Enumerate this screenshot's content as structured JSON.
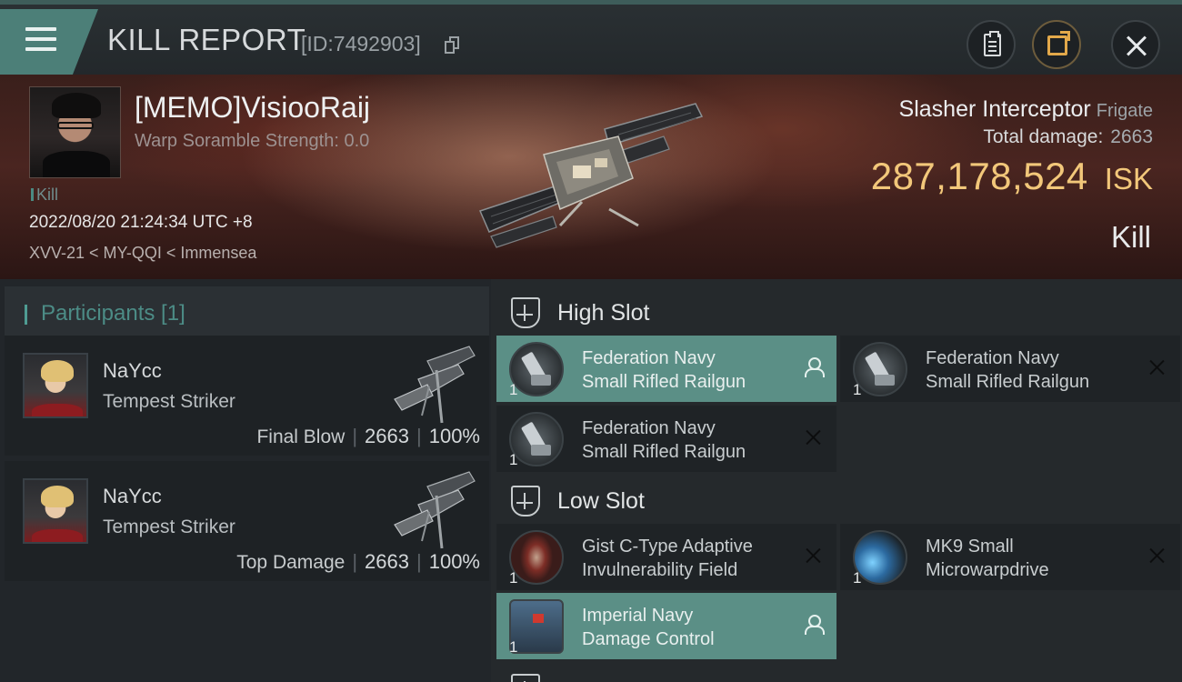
{
  "header": {
    "title": "KILL REPORT",
    "kill_id": "[ID:7492903]"
  },
  "victim": {
    "name": "[MEMO]VisiooRaij",
    "warp_scramble": "Warp Soramble Strength: 0.0",
    "kill_tag": "Kill",
    "datetime": "2022/08/20 21:24:34 UTC +8",
    "location": "XVV-21 < MY-QQI < Immensea",
    "ship_name": "Slasher Interceptor",
    "ship_class": "Frigate",
    "total_damage_label": "Total damage:",
    "total_damage": "2663",
    "isk_value": "287,178,524",
    "isk_unit": "ISK",
    "result": "Kill"
  },
  "participants": {
    "title": "Participants [1]",
    "items": [
      {
        "name": "NaYcc",
        "ship": "Tempest Striker",
        "label": "Final Blow",
        "damage": "2663",
        "percent": "100%"
      },
      {
        "name": "NaYcc",
        "ship": "Tempest Striker",
        "label": "Top Damage",
        "damage": "2663",
        "percent": "100%"
      }
    ]
  },
  "fitting": {
    "high_slot_title": "High Slot",
    "low_slot_title": "Low Slot",
    "high_slot": [
      {
        "name_line1": "Federation Navy",
        "name_line2": "Small Rifled Railgun",
        "qty": "1",
        "status": "dropped",
        "icon": "railgun-icon"
      },
      {
        "name_line1": "Federation Navy",
        "name_line2": "Small Rifled Railgun",
        "qty": "1",
        "status": "destroyed",
        "icon": "railgun-icon"
      },
      {
        "name_line1": "Federation Navy",
        "name_line2": "Small Rifled Railgun",
        "qty": "1",
        "status": "destroyed",
        "icon": "railgun-icon"
      }
    ],
    "low_slot": [
      {
        "name_line1": "Gist C-Type Adaptive",
        "name_line2": "Invulnerability Field",
        "qty": "1",
        "status": "destroyed",
        "icon": "invulnerability-field-icon"
      },
      {
        "name_line1": "MK9 Small",
        "name_line2": "Microwarpdrive",
        "qty": "1",
        "status": "destroyed",
        "icon": "microwarpdrive-icon"
      },
      {
        "name_line1": "Imperial Navy",
        "name_line2": "Damage Control",
        "qty": "1",
        "status": "dropped",
        "icon": "damage-control-icon"
      }
    ]
  },
  "colors": {
    "accent_teal": "#5b8f86",
    "isk_gold": "#f2c77a",
    "share_orange": "#e2a84a"
  }
}
